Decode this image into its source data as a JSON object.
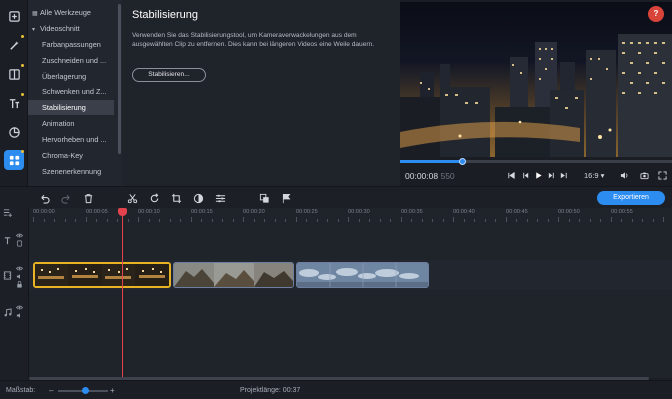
{
  "rail": {
    "items": [
      {
        "icon": "import-icon",
        "active": false,
        "dot": false
      },
      {
        "icon": "magic-wand-icon",
        "active": false,
        "dot": true
      },
      {
        "icon": "transitions-icon",
        "active": false,
        "dot": true
      },
      {
        "icon": "titles-icon",
        "active": false,
        "dot": true
      },
      {
        "icon": "stickers-icon",
        "active": false,
        "dot": false
      },
      {
        "icon": "more-tools-icon",
        "active": true,
        "dot": true
      }
    ]
  },
  "tools": {
    "all_tools": "Alle Werkzeuge",
    "video_section": "Videoschnitt",
    "items": [
      "Farbanpassungen",
      "Zuschneiden und ...",
      "Überlagerung",
      "Schwenken und Z...",
      "Stabilisierung",
      "Animation",
      "Hervorheben und ...",
      "Chroma-Key",
      "Szenenerkennung"
    ],
    "active_index": 4
  },
  "info": {
    "title": "Stabilisierung",
    "description": "Verwenden Sie das Stabilisierungstool, um Kameraverwackelungen aus dem ausgewählten Clip zu entfernen. Dies kann bei längeren Videos eine Weile dauern.",
    "button": "Stabilisieren..."
  },
  "preview": {
    "help": "?",
    "progress": 0.23,
    "timecode": "00:00:08",
    "timecode_ms": "550",
    "aspect_ratio": "16:9 ▾"
  },
  "toolbar": {
    "export_label": "Exportieren"
  },
  "timeline": {
    "ruler": [
      "00:00:00",
      "00:00:05",
      "00:00:10",
      "00:00:15",
      "00:00:20",
      "00:00:25",
      "00:00:30",
      "00:00:35",
      "00:00:40",
      "00:00:45",
      "00:00:50",
      "00:00:55"
    ],
    "clips": [
      {
        "name": "clip-city-night",
        "selected": true
      },
      {
        "name": "clip-mountains",
        "selected": false
      },
      {
        "name": "clip-sky-clouds",
        "selected": false
      }
    ]
  },
  "status": {
    "scale_label": "Maßstab:",
    "zoom": 0.55,
    "project_length": "Projektlänge: 00:37"
  },
  "colors": {
    "accent": "#2d8cf0",
    "selection": "#e8b423",
    "playhead": "#e3434d",
    "help": "#d9443a"
  }
}
